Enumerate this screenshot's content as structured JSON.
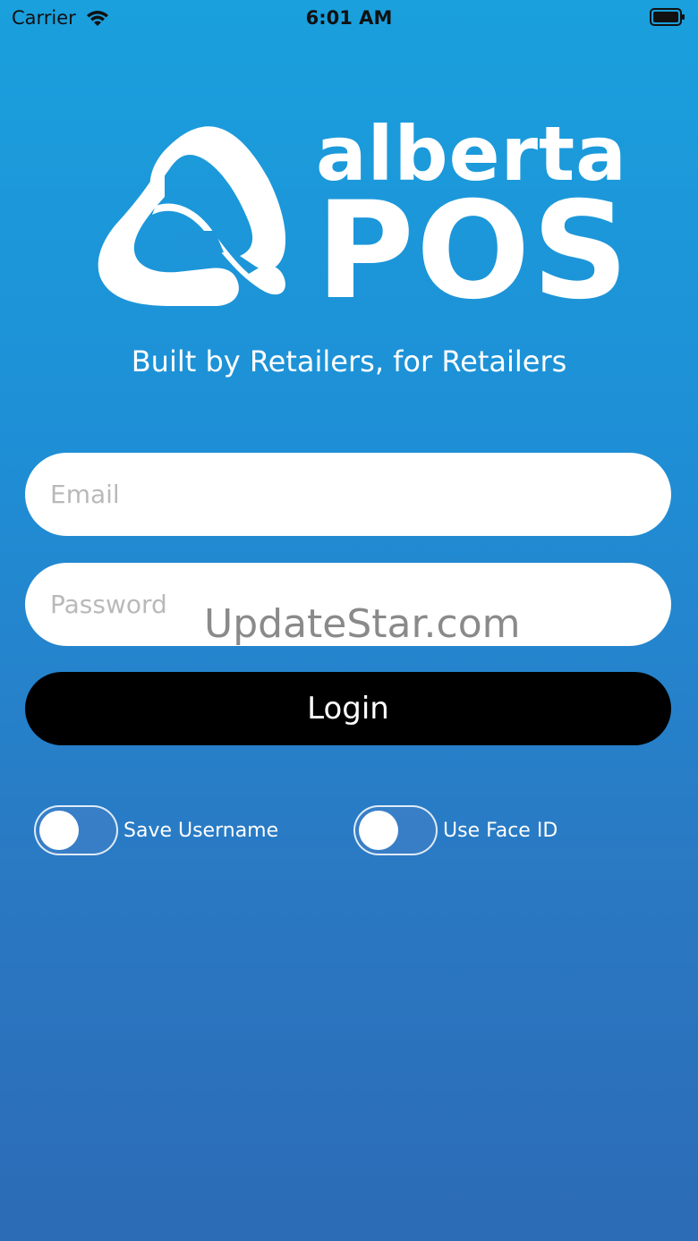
{
  "status_bar": {
    "carrier": "Carrier",
    "time": "6:01 AM"
  },
  "brand": {
    "line1": "alberta",
    "line2": "POS",
    "tagline": "Built by Retailers, for Retailers"
  },
  "form": {
    "email_placeholder": "Email",
    "password_placeholder": "Password",
    "login_label": "Login"
  },
  "toggles": {
    "save_username": {
      "label": "Save Username",
      "on": false
    },
    "use_face_id": {
      "label": "Use Face ID",
      "on": false
    }
  },
  "watermark": "UpdateStar.com",
  "colors": {
    "background_top": "#1aa0dd",
    "background_bottom": "#2c6bb6",
    "button": "#000000",
    "field": "#ffffff"
  }
}
